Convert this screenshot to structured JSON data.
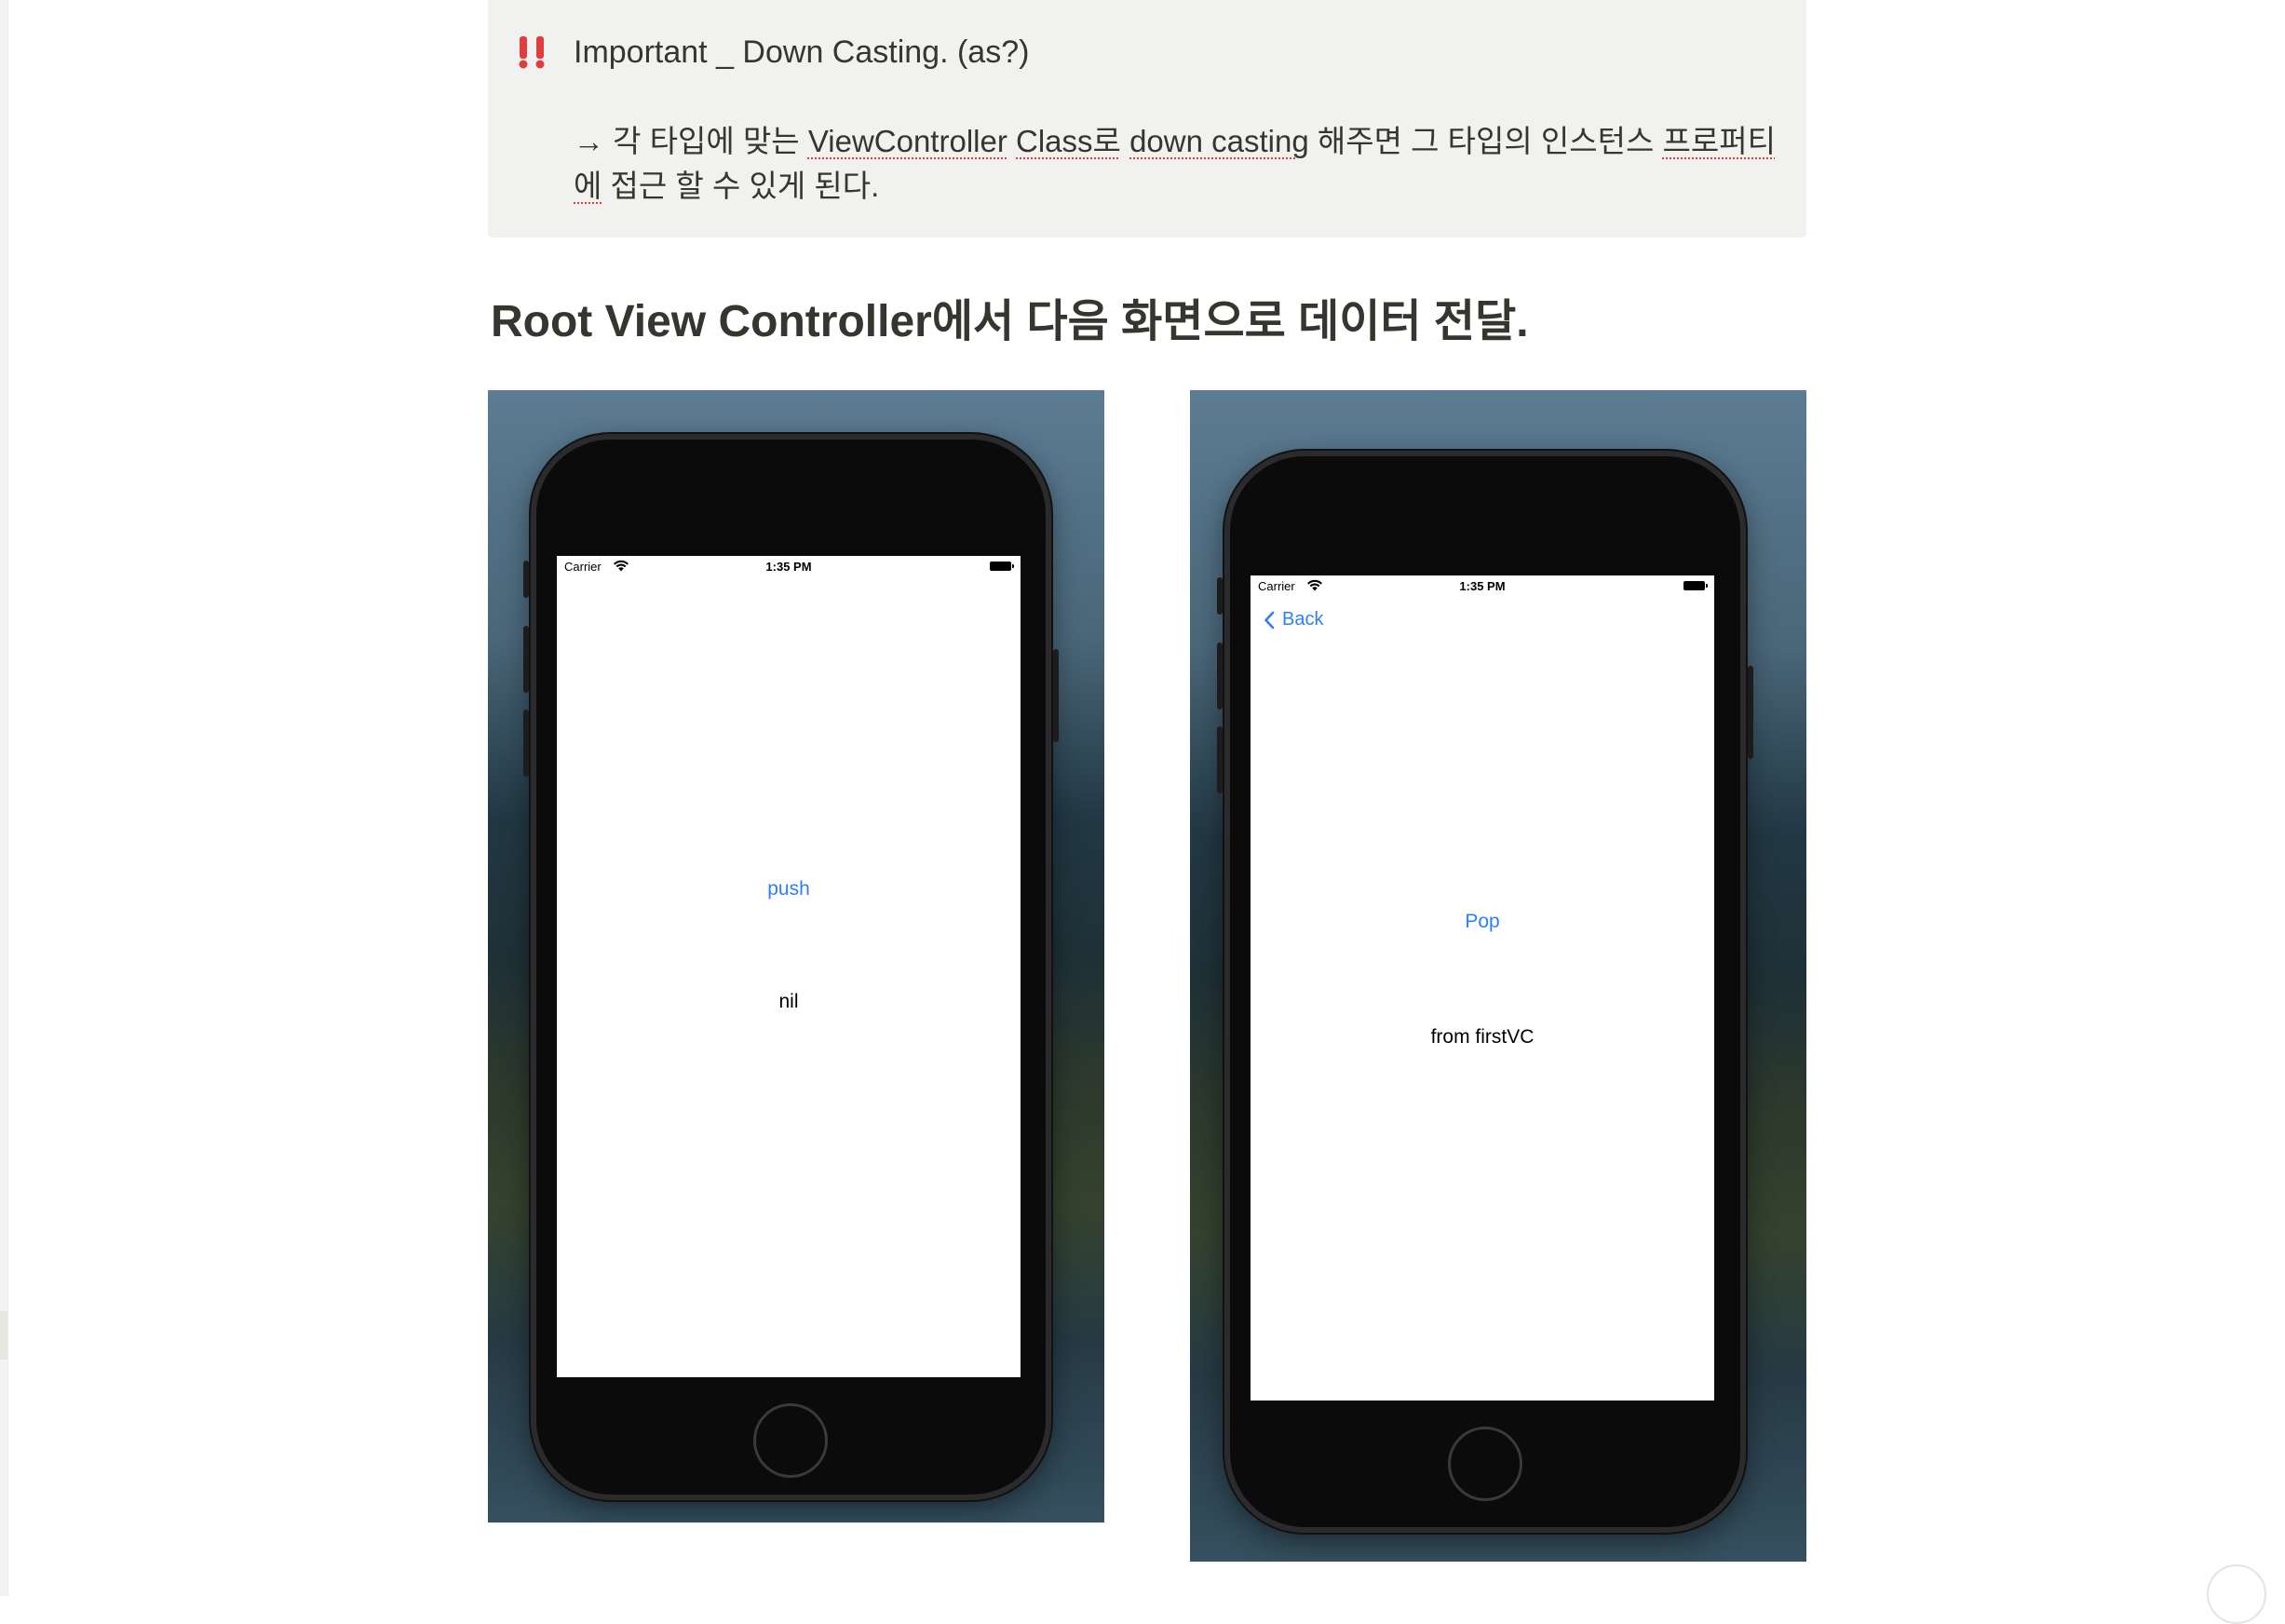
{
  "callout": {
    "icon": "double-exclamation-icon",
    "title": "Important _ Down Casting. (as?)",
    "body": {
      "seg1": "→ 각 타입에 맞는 ",
      "seg2": "ViewController",
      "seg3": " ",
      "seg4": "Class로",
      "seg5": " ",
      "seg6": "down casting",
      "seg7": " 해주면 그 타입의 인스턴스 ",
      "seg8": "프로퍼티에",
      "seg9": " 접근 할 수 있게 된다."
    }
  },
  "heading": "Root View Controller에서 다음 화면으로 데이터 전달.",
  "screens": {
    "first": {
      "carrier": "Carrier",
      "time": "1:35 PM",
      "button": "push",
      "label": "nil"
    },
    "second": {
      "carrier": "Carrier",
      "time": "1:35 PM",
      "back": "Back",
      "button": "Pop",
      "label": "from firstVC"
    }
  },
  "colors": {
    "callout_bg": "#f1f1ef",
    "ios_tint": "#2d7ff9",
    "alert_red": "#e03e3e",
    "text": "#37352f"
  }
}
